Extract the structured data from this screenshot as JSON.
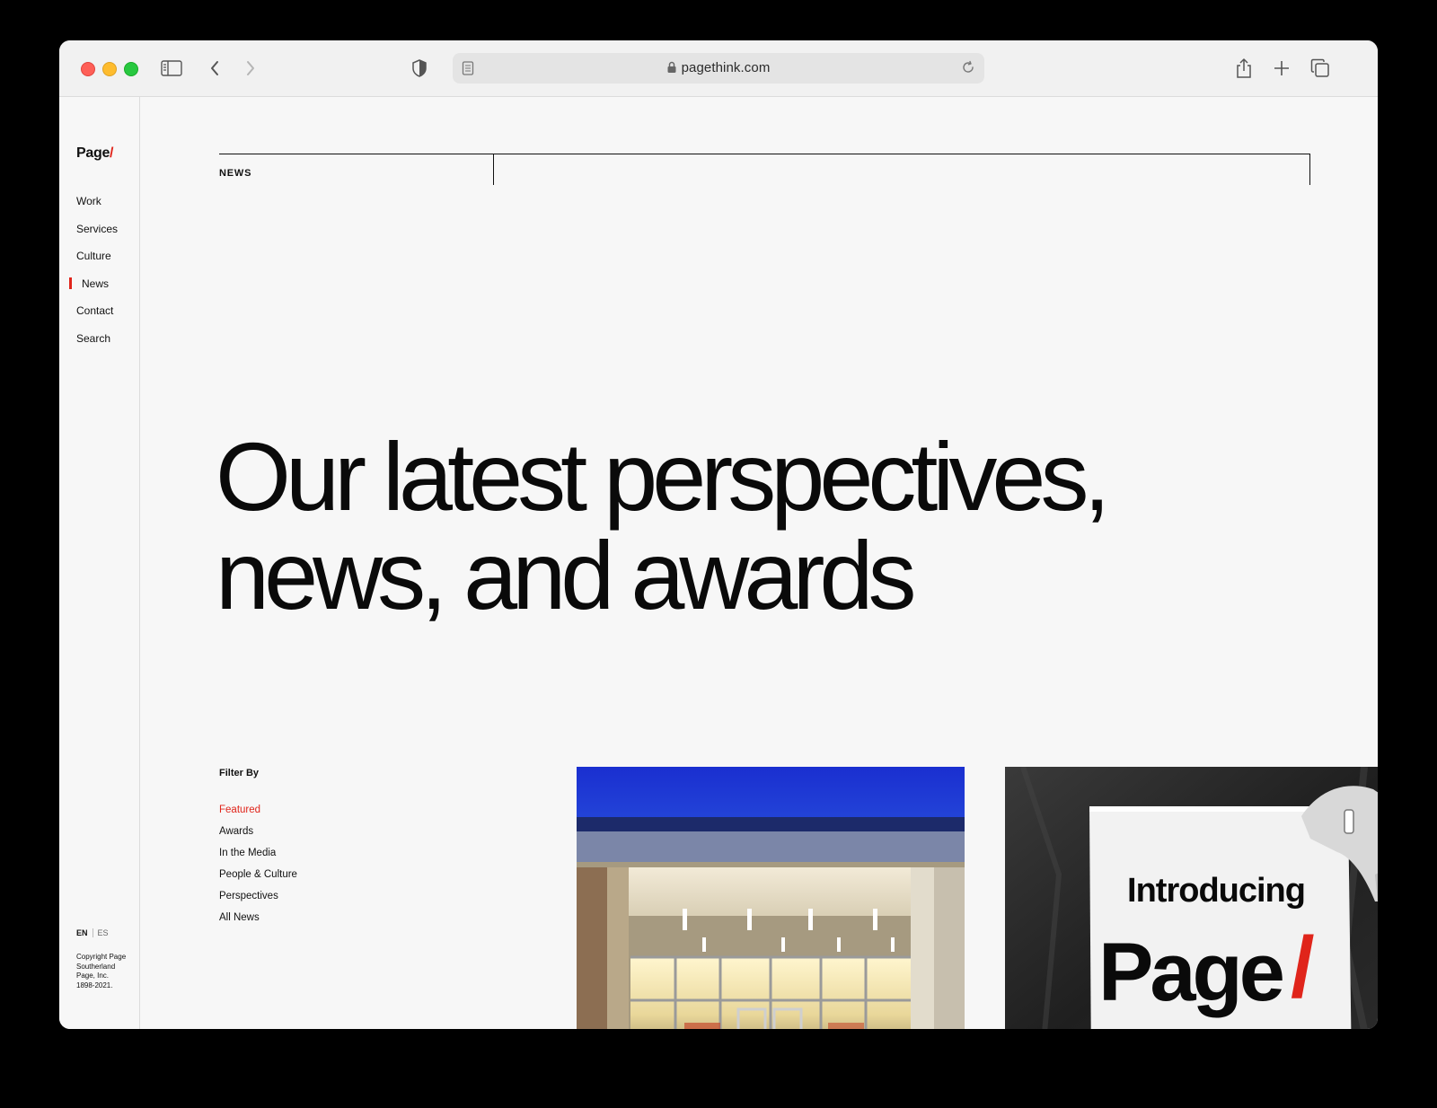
{
  "browser": {
    "url": "pagethink.com"
  },
  "sidebar": {
    "logo_text": "Page",
    "logo_slash": "/",
    "nav": [
      {
        "label": "Work"
      },
      {
        "label": "Services"
      },
      {
        "label": "Culture"
      },
      {
        "label": "News",
        "active": true
      },
      {
        "label": "Contact"
      },
      {
        "label": "Search"
      }
    ],
    "lang_en": "EN",
    "lang_es": "ES",
    "copyright": "Copyright Page Southerland Page, Inc. 1898-2021."
  },
  "main": {
    "section_label": "NEWS",
    "headline_line1": "Our latest perspectives,",
    "headline_line2": "news, and awards",
    "filter": {
      "title": "Filter By",
      "items": [
        {
          "label": "Featured",
          "active": true
        },
        {
          "label": "Awards"
        },
        {
          "label": "In the Media"
        },
        {
          "label": "People & Culture"
        },
        {
          "label": "Perspectives"
        },
        {
          "label": "All News"
        }
      ]
    },
    "cards": [
      {
        "image": "building-entrance-photo"
      },
      {
        "image": "introducing-page-sign-photo",
        "sign_line1": "Introducing",
        "sign_line2": "Page",
        "sign_slash": "/"
      }
    ]
  },
  "colors": {
    "accent": "#e0251b",
    "background": "#f7f7f7",
    "text": "#111111"
  }
}
